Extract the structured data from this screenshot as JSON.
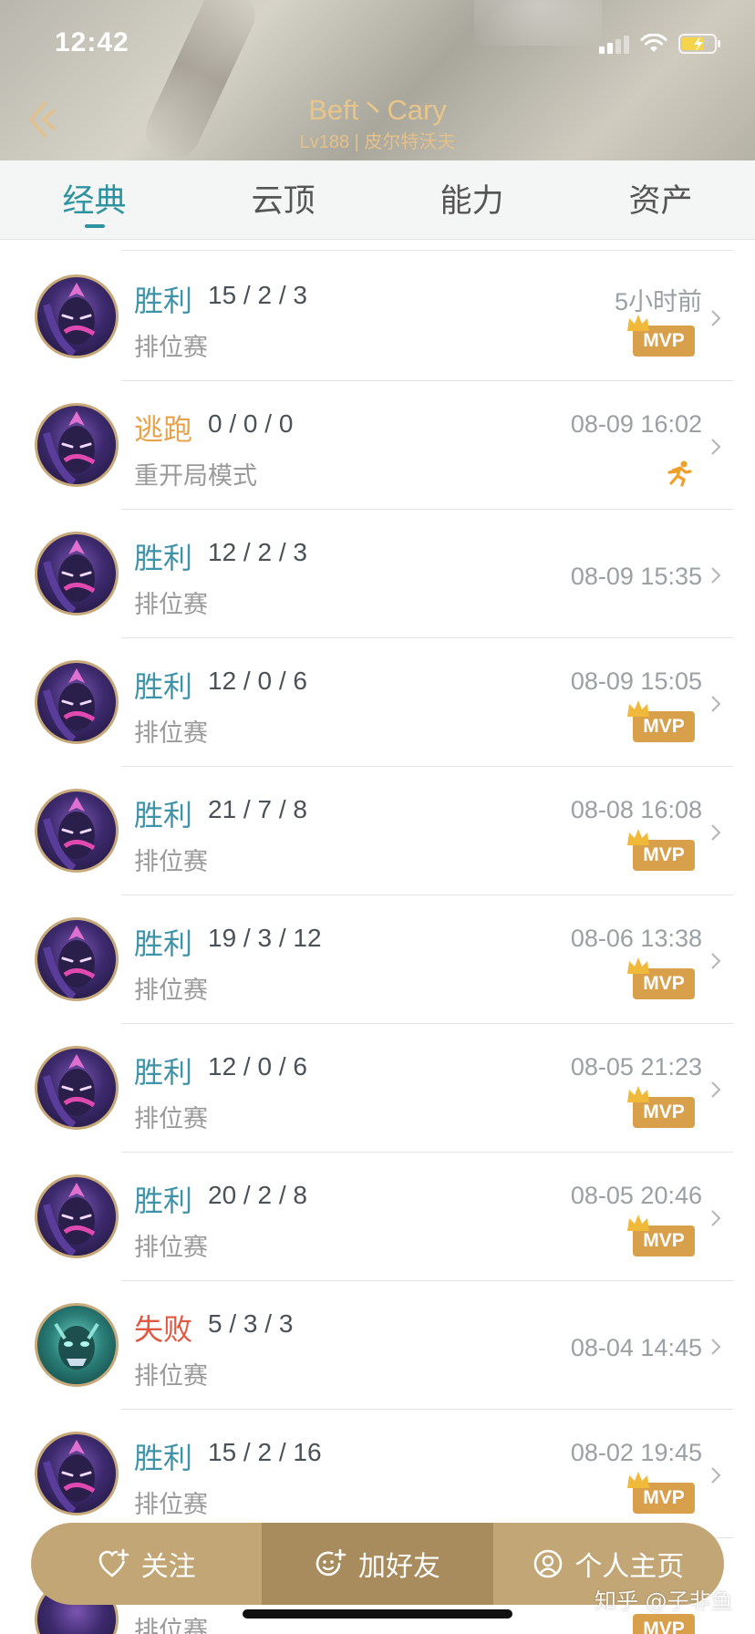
{
  "status_bar": {
    "time": "12:42"
  },
  "header": {
    "title": "Beft丶Cary",
    "subtitle": "Lv188 | 皮尔特沃夫"
  },
  "tabs": [
    {
      "label": "经典",
      "active": true
    },
    {
      "label": "云顶",
      "active": false
    },
    {
      "label": "能力",
      "active": false
    },
    {
      "label": "资产",
      "active": false
    }
  ],
  "matches": [
    {
      "result": "胜利",
      "kind": "win",
      "kda": "15 / 2 / 3",
      "mode": "排位赛",
      "time": "5小时前",
      "badge": "MVP",
      "champion": "purple"
    },
    {
      "result": "逃跑",
      "kind": "escape",
      "kda": "0 / 0 / 0",
      "mode": "重开局模式",
      "time": "08-09 16:02",
      "badge": "escape",
      "champion": "purple"
    },
    {
      "result": "胜利",
      "kind": "win",
      "kda": "12 / 2 / 3",
      "mode": "排位赛",
      "time": "08-09 15:35",
      "badge": "",
      "champion": "purple"
    },
    {
      "result": "胜利",
      "kind": "win",
      "kda": "12 / 0 / 6",
      "mode": "排位赛",
      "time": "08-09 15:05",
      "badge": "MVP",
      "champion": "purple"
    },
    {
      "result": "胜利",
      "kind": "win",
      "kda": "21 / 7 / 8",
      "mode": "排位赛",
      "time": "08-08 16:08",
      "badge": "MVP",
      "champion": "purple"
    },
    {
      "result": "胜利",
      "kind": "win",
      "kda": "19 / 3 / 12",
      "mode": "排位赛",
      "time": "08-06 13:38",
      "badge": "MVP",
      "champion": "purple"
    },
    {
      "result": "胜利",
      "kind": "win",
      "kda": "12 / 0 / 6",
      "mode": "排位赛",
      "time": "08-05 21:23",
      "badge": "MVP",
      "champion": "purple"
    },
    {
      "result": "胜利",
      "kind": "win",
      "kda": "20 / 2 / 8",
      "mode": "排位赛",
      "time": "08-05 20:46",
      "badge": "MVP",
      "champion": "purple"
    },
    {
      "result": "失败",
      "kind": "lose",
      "kda": "5 / 3 / 3",
      "mode": "排位赛",
      "time": "08-04 14:45",
      "badge": "",
      "champion": "teal"
    },
    {
      "result": "胜利",
      "kind": "win",
      "kda": "15 / 2 / 16",
      "mode": "排位赛",
      "time": "08-02 19:45",
      "badge": "MVP",
      "champion": "purple"
    }
  ],
  "partial_row": {
    "mode": "排位赛",
    "badge": "MVP"
  },
  "actions": {
    "follow": "关注",
    "add_friend": "加好友",
    "profile": "个人主页"
  },
  "watermark": "知乎 @子非鱼",
  "colors": {
    "win": "#3f93a8",
    "escape": "#e7a34b",
    "lose": "#e2573f",
    "accent": "#2e93a0",
    "gold": "#d9a04b"
  }
}
